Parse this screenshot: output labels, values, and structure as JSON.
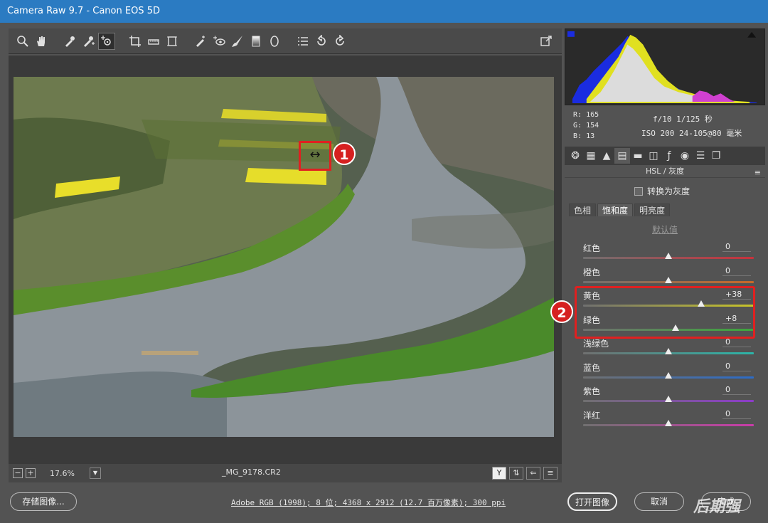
{
  "window": {
    "title": "Camera Raw 9.7 -  Canon EOS 5D"
  },
  "preview": {
    "zoom": "17.6%",
    "filename": "_MG_9178.CR2",
    "callouts": [
      "1",
      "2"
    ]
  },
  "histogram": {
    "r_label": "R:",
    "r_value": "165",
    "g_label": "G:",
    "g_value": "154",
    "b_label": "B:",
    "b_value": "13",
    "exposure": "f/10  1/125 秒",
    "iso_lens": "ISO 200  24-105@80 毫米"
  },
  "panel": {
    "title": "HSL / 灰度",
    "grayscale_label": "转换为灰度",
    "subtabs": [
      "色相",
      "饱和度",
      "明亮度"
    ],
    "default_label": "默认值",
    "sliders": [
      {
        "label": "红色",
        "value": "0",
        "amount": 0,
        "color": "#c8323c"
      },
      {
        "label": "橙色",
        "value": "0",
        "amount": 0,
        "color": "#c86a28"
      },
      {
        "label": "黄色",
        "value": "+38",
        "amount": 38,
        "color": "#c8c428"
      },
      {
        "label": "绿色",
        "value": "+8",
        "amount": 8,
        "color": "#3ca83c"
      },
      {
        "label": "浅绿色",
        "value": "0",
        "amount": 0,
        "color": "#2cb4a8"
      },
      {
        "label": "蓝色",
        "value": "0",
        "amount": 0,
        "color": "#2c6cc8"
      },
      {
        "label": "紫色",
        "value": "0",
        "amount": 0,
        "color": "#8c3cc8"
      },
      {
        "label": "洋红",
        "value": "0",
        "amount": 0,
        "color": "#c83ca8"
      }
    ]
  },
  "footer": {
    "save_label": "存储图像...",
    "info": "Adobe RGB (1998); 8 位; 4368 x 2912 (12.7 百万像素); 300 ppi",
    "open_label": "打开图像",
    "cancel_label": "取消",
    "done_label": "完成",
    "watermark": "后期强"
  }
}
